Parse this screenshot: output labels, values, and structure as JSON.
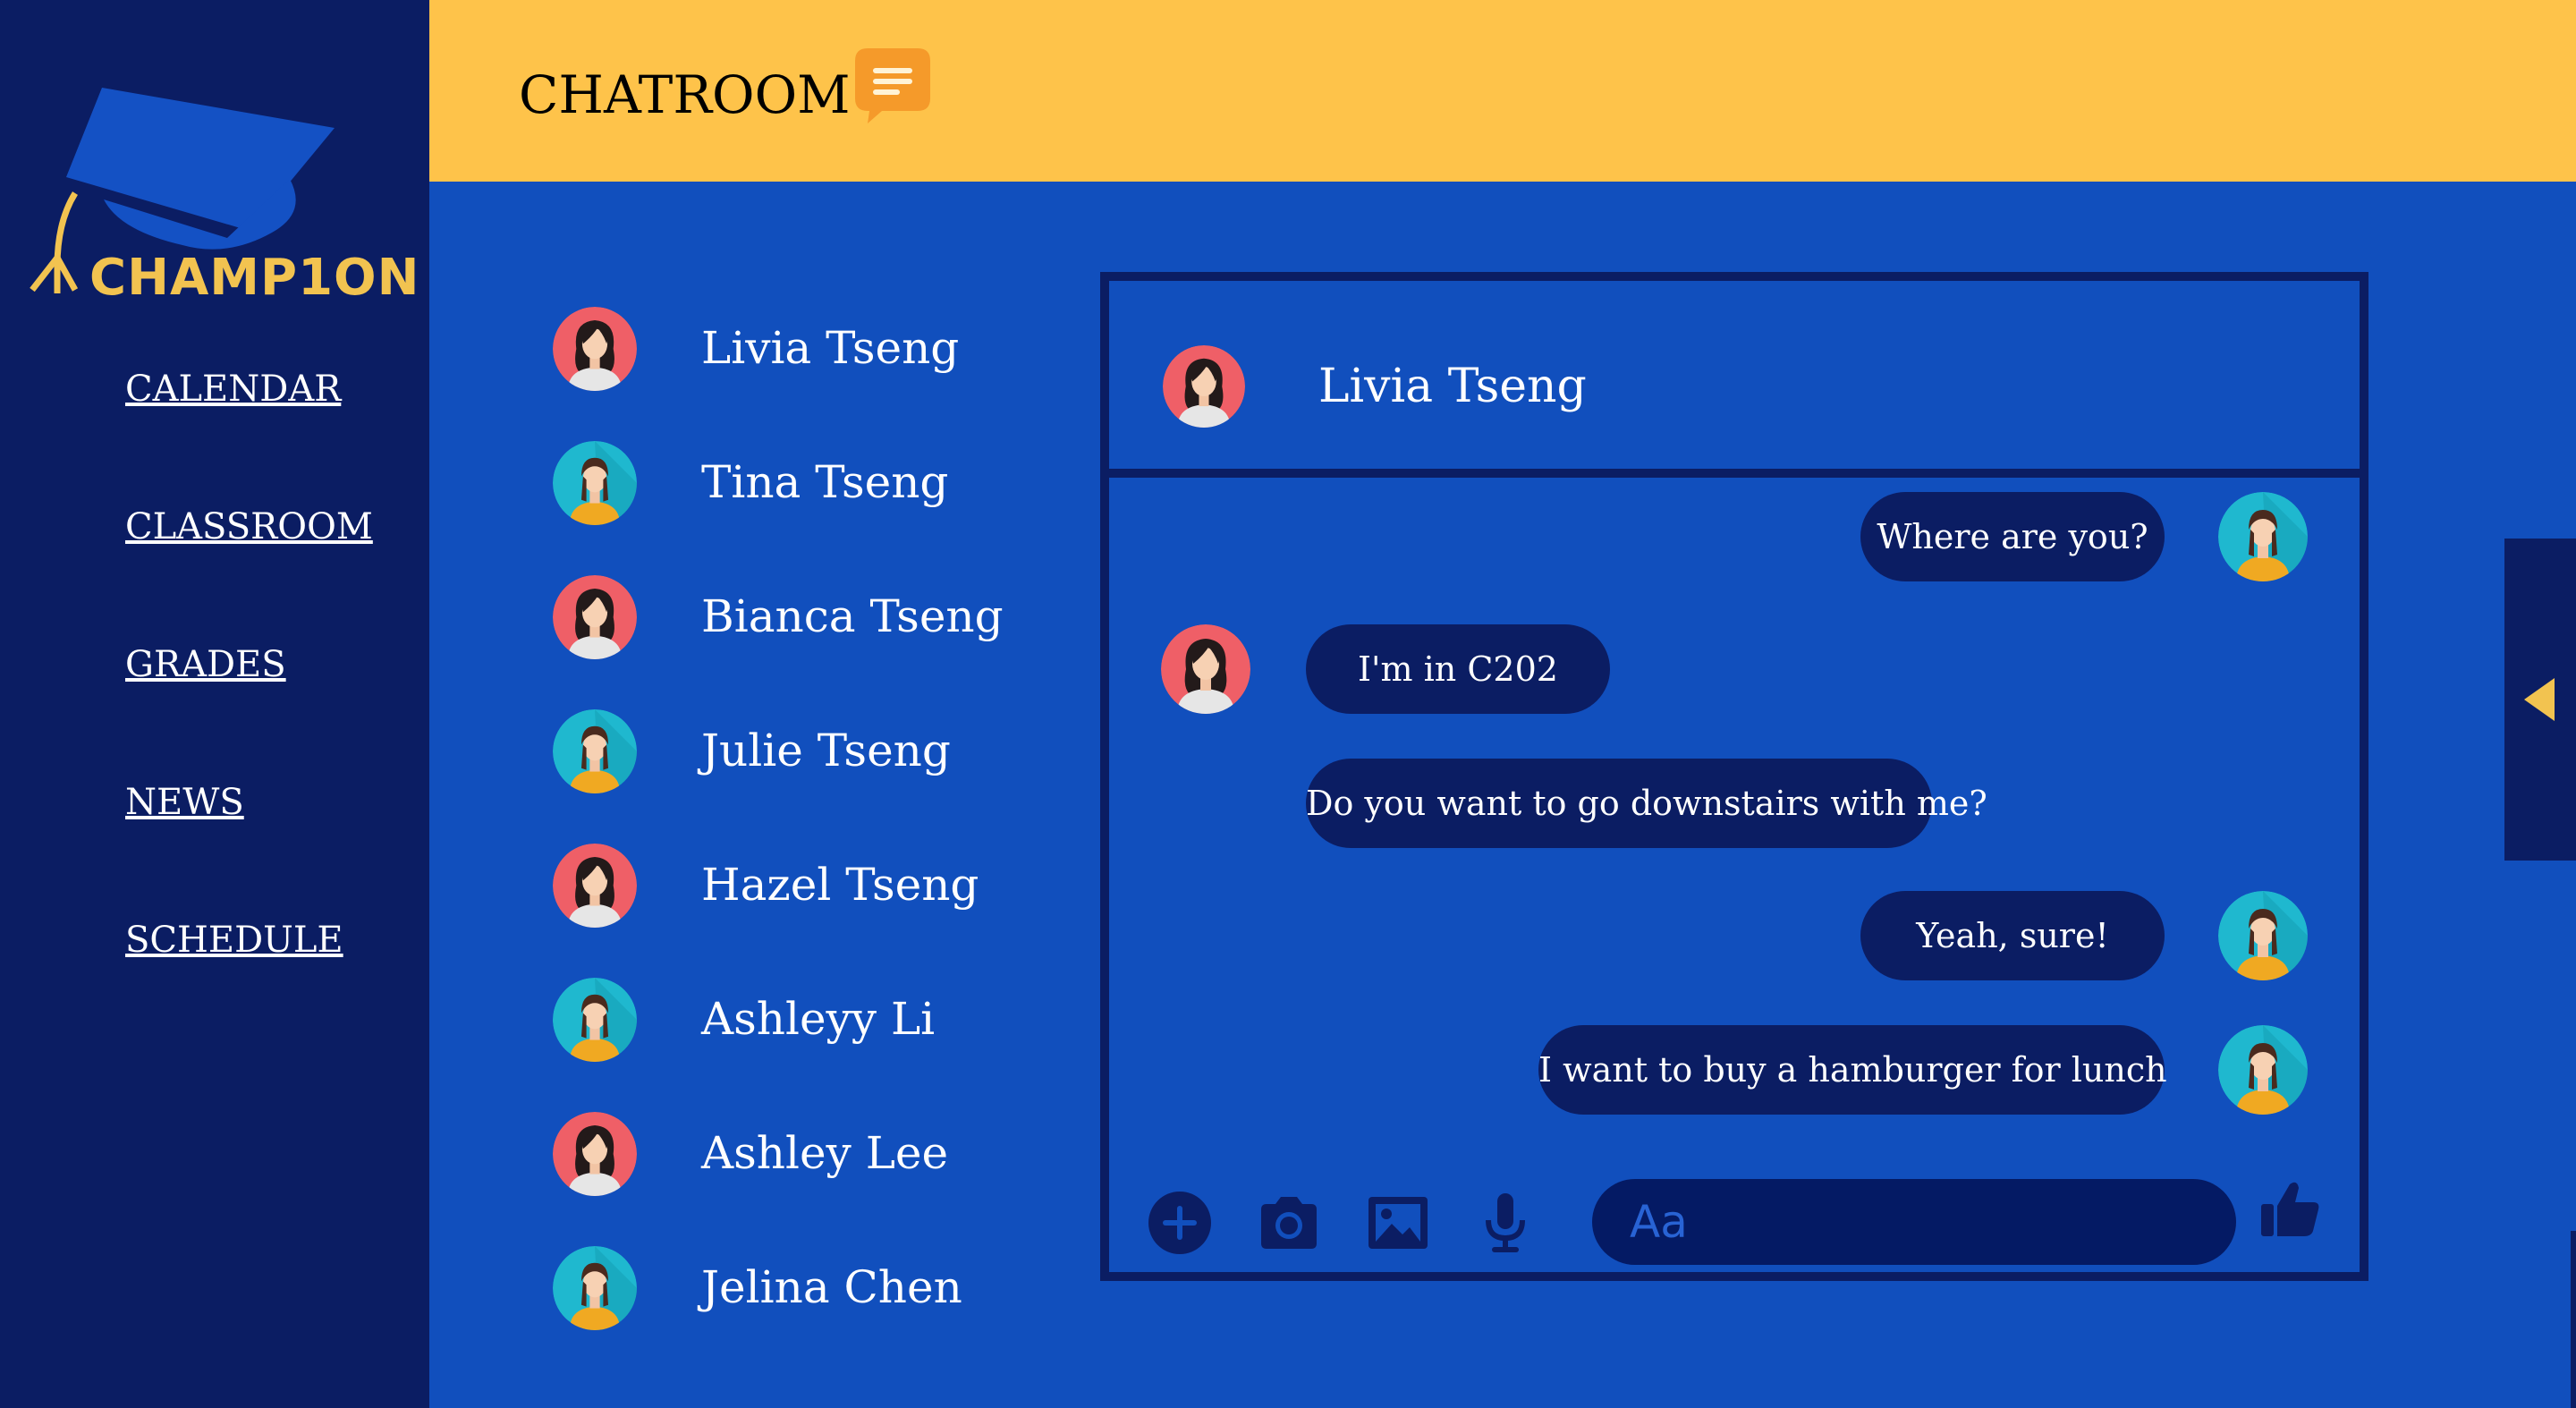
{
  "app": {
    "brand": "CHAMP1ON"
  },
  "sidebar": {
    "items": [
      {
        "label": "CALENDAR"
      },
      {
        "label": "CLASSROOM"
      },
      {
        "label": "GRADES"
      },
      {
        "label": "NEWS"
      },
      {
        "label": "SCHEDULE"
      }
    ]
  },
  "header": {
    "title": "CHATROOM",
    "icon": "chat-bubble-icon"
  },
  "contacts": [
    {
      "name": "Livia Tseng",
      "avatar": "red"
    },
    {
      "name": "Tina Tseng",
      "avatar": "teal"
    },
    {
      "name": "Bianca Tseng",
      "avatar": "red"
    },
    {
      "name": "Julie Tseng",
      "avatar": "teal"
    },
    {
      "name": "Hazel Tseng",
      "avatar": "red"
    },
    {
      "name": "Ashleyy Li",
      "avatar": "teal"
    },
    {
      "name": "Ashley Lee",
      "avatar": "red"
    },
    {
      "name": "Jelina Chen",
      "avatar": "teal"
    }
  ],
  "chat": {
    "partner_name": "Livia Tseng",
    "messages": [
      {
        "text": "Where are you?",
        "from": "me"
      },
      {
        "text": "I'm in C202",
        "from": "them"
      },
      {
        "text": "Do you want to go downstairs with me?",
        "from": "them"
      },
      {
        "text": "Yeah, sure!",
        "from": "me"
      },
      {
        "text": "I want to buy a hamburger for lunch",
        "from": "me"
      }
    ],
    "input_placeholder": "Aa",
    "toolbar_icons": [
      "plus-icon",
      "camera-icon",
      "image-icon",
      "microphone-icon",
      "thumbs-up-icon"
    ]
  },
  "colors": {
    "sidebar": "#0b1d63",
    "header": "#fec34a",
    "main": "#114fbd",
    "bubble": "#0b1d63",
    "accent": "#f2c350",
    "avatar_red": "#ef5f67",
    "avatar_teal": "#1fb8cf"
  }
}
